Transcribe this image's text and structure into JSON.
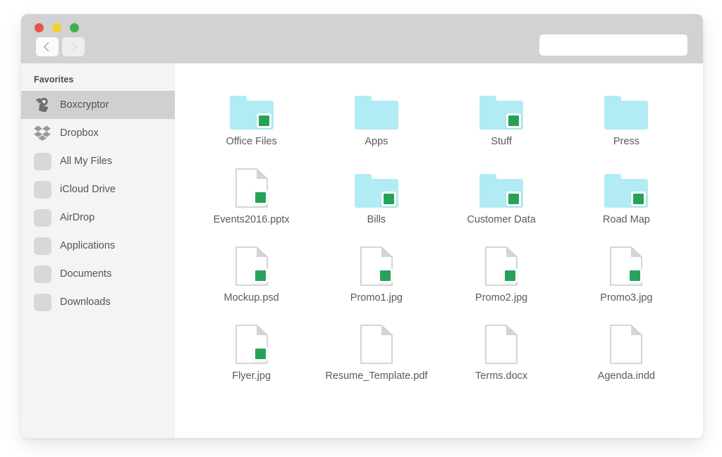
{
  "window": {
    "traffic_lights": [
      {
        "name": "close",
        "color": "#e8544a"
      },
      {
        "name": "minimize",
        "color": "#f2d02e"
      },
      {
        "name": "zoom",
        "color": "#3cb24c"
      }
    ],
    "nav": {
      "back_label": "‹",
      "forward_label": "›"
    },
    "search": {
      "value": "",
      "placeholder": ""
    }
  },
  "sidebar": {
    "header": "Favorites",
    "items": [
      {
        "label": "Boxcryptor",
        "icon": "boxcryptor-icon",
        "selected": true
      },
      {
        "label": "Dropbox",
        "icon": "dropbox-icon",
        "selected": false
      },
      {
        "label": "All My Files",
        "icon": "generic-icon",
        "selected": false
      },
      {
        "label": "iCloud Drive",
        "icon": "generic-icon",
        "selected": false
      },
      {
        "label": "AirDrop",
        "icon": "generic-icon",
        "selected": false
      },
      {
        "label": "Applications",
        "icon": "generic-icon",
        "selected": false
      },
      {
        "label": "Documents",
        "icon": "generic-icon",
        "selected": false
      },
      {
        "label": "Downloads",
        "icon": "generic-icon",
        "selected": false
      }
    ]
  },
  "content": {
    "folder_color": "#b1ecf4",
    "badge_color": "#27a25a",
    "items": [
      {
        "name": "Office Files",
        "type": "folder",
        "encrypted": true
      },
      {
        "name": "Apps",
        "type": "folder",
        "encrypted": false
      },
      {
        "name": "Stuff",
        "type": "folder",
        "encrypted": true
      },
      {
        "name": "Press",
        "type": "folder",
        "encrypted": false
      },
      {
        "name": "Events2016.pptx",
        "type": "document",
        "encrypted": true
      },
      {
        "name": "Bills",
        "type": "folder",
        "encrypted": true
      },
      {
        "name": "Customer Data",
        "type": "folder",
        "encrypted": true
      },
      {
        "name": "Road Map",
        "type": "folder",
        "encrypted": true
      },
      {
        "name": "Mockup.psd",
        "type": "document",
        "encrypted": true
      },
      {
        "name": "Promo1.jpg",
        "type": "document",
        "encrypted": true
      },
      {
        "name": "Promo2.jpg",
        "type": "document",
        "encrypted": true
      },
      {
        "name": "Promo3.jpg",
        "type": "document",
        "encrypted": true
      },
      {
        "name": "Flyer.jpg",
        "type": "document",
        "encrypted": true
      },
      {
        "name": "Resume_Template.pdf",
        "type": "document",
        "encrypted": false
      },
      {
        "name": "Terms.docx",
        "type": "document",
        "encrypted": false
      },
      {
        "name": "Agenda.indd",
        "type": "document",
        "encrypted": false
      }
    ]
  }
}
